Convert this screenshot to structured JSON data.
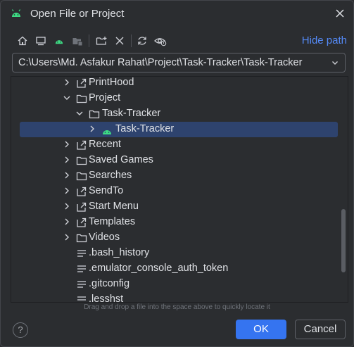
{
  "dialog": {
    "title": "Open File or Project",
    "hide_path_label": "Hide path",
    "path_value": "C:\\Users\\Md. Asfakur Rahat\\Project\\Task-Tracker\\Task-Tracker",
    "hint": "Drag and drop a file into the space above to quickly locate it",
    "help_label": "?",
    "ok_label": "OK",
    "cancel_label": "Cancel"
  },
  "toolbar": {
    "icons": [
      "home-icon",
      "desktop-icon",
      "android-project-icon",
      "folder-module-icon",
      "new-folder-icon",
      "delete-icon",
      "refresh-icon",
      "show-hidden-icon"
    ]
  },
  "tree": {
    "items": [
      {
        "label": "PrintHood",
        "icon": "folder-link-icon",
        "expanded": false,
        "depth": 0
      },
      {
        "label": "Project",
        "icon": "folder-icon",
        "expanded": true,
        "depth": 0
      },
      {
        "label": "Task-Tracker",
        "icon": "folder-icon",
        "expanded": true,
        "depth": 1
      },
      {
        "label": "Task-Tracker",
        "icon": "android-icon",
        "expanded": false,
        "depth": 2,
        "selected": true
      },
      {
        "label": "Recent",
        "icon": "folder-link-icon",
        "expanded": false,
        "depth": 0
      },
      {
        "label": "Saved Games",
        "icon": "folder-icon",
        "expanded": false,
        "depth": 0
      },
      {
        "label": "Searches",
        "icon": "folder-icon",
        "expanded": false,
        "depth": 0
      },
      {
        "label": "SendTo",
        "icon": "folder-link-icon",
        "expanded": false,
        "depth": 0
      },
      {
        "label": "Start Menu",
        "icon": "folder-link-icon",
        "expanded": false,
        "depth": 0
      },
      {
        "label": "Templates",
        "icon": "folder-link-icon",
        "expanded": false,
        "depth": 0
      },
      {
        "label": "Videos",
        "icon": "folder-icon",
        "expanded": false,
        "depth": 0
      },
      {
        "label": ".bash_history",
        "icon": "text-file-icon",
        "depth": 0
      },
      {
        "label": ".emulator_console_auth_token",
        "icon": "text-file-icon",
        "depth": 0
      },
      {
        "label": ".gitconfig",
        "icon": "text-file-icon",
        "depth": 0
      },
      {
        "label": ".lesshst",
        "icon": "text-file-icon",
        "depth": 0
      }
    ]
  },
  "colors": {
    "background": "#2b2d30",
    "accent": "#3574f0",
    "link": "#548af7",
    "selection": "#2e436e",
    "android": "#3ddc84"
  }
}
